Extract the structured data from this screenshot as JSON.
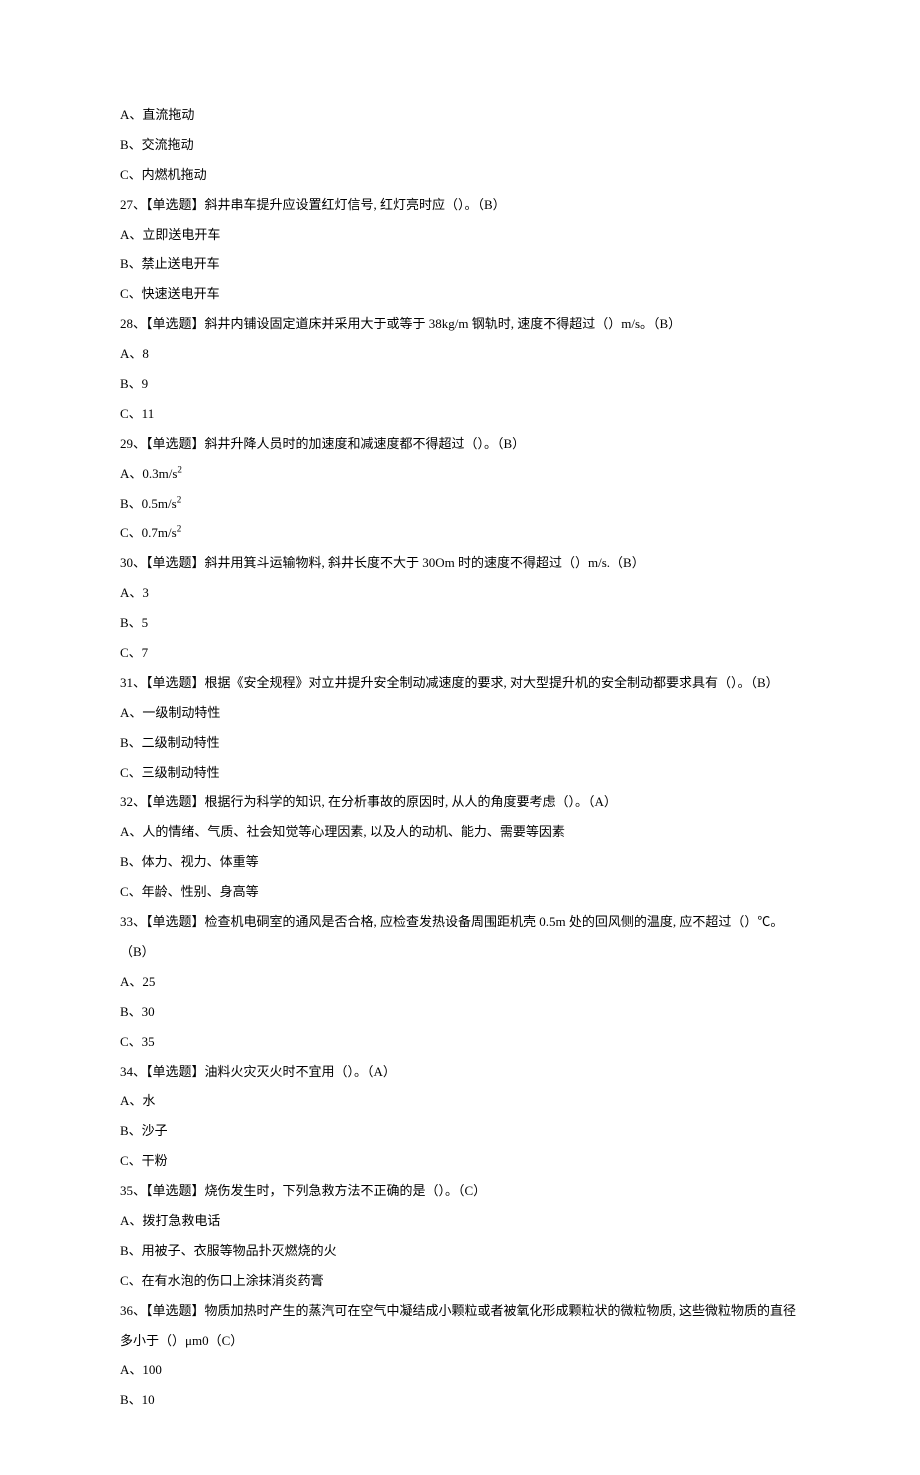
{
  "lines": [
    "A、直流拖动",
    "B、交流拖动",
    "C、内燃机拖动",
    "27、【单选题】斜井串车提升应设置红灯信号, 红灯亮时应（）。（B）",
    "A、立即送电开车",
    "B、禁止送电开车",
    "C、快速送电开车",
    "28、【单选题】斜井内铺设固定道床并采用大于或等于 38kg/m 钢轨时, 速度不得超过（）m/s。（B）",
    "A、8",
    "B、9",
    "C、11",
    "29、【单选题】斜井升降人员时的加速度和减速度都不得超过（）。（B）",
    "A、0.3m/s²",
    "B、0.5m/s²",
    "C、0.7m/s²",
    "30、【单选题】斜井用箕斗运输物料, 斜井长度不大于 30Om 时的速度不得超过（）m/s.（B）",
    "A、3",
    "B、5",
    "C、7",
    "31、【单选题】根据《安全规程》对立井提升安全制动减速度的要求, 对大型提升机的安全制动都要求具有（）。（B）",
    "A、一级制动特性",
    "B、二级制动特性",
    "C、三级制动特性",
    "32、【单选题】根据行为科学的知识, 在分析事故的原因时, 从人的角度要考虑（）。（A）",
    "A、人的情绪、气质、社会知觉等心理因素, 以及人的动机、能力、需要等因素",
    "B、体力、视力、体重等",
    "C、年龄、性别、身高等",
    "33、【单选题】检查机电硐室的通风是否合格, 应检查发热设备周围距机壳 0.5m 处的回风侧的温度, 应不超过（）℃。（B）",
    "A、25",
    "B、30",
    "C、35",
    "34、【单选题】油料火灾灭火时不宜用（）。（A）",
    "A、水",
    "B、沙子",
    "C、干粉",
    "35、【单选题】烧伤发生时，下列急救方法不正确的是（）。（C）",
    "A、拨打急救电话",
    "B、用被子、衣服等物品扑灭燃烧的火",
    "C、在有水泡的伤口上涂抹消炎药膏",
    "36、【单选题】物质加热时产生的蒸汽可在空气中凝结成小颗粒或者被氧化形成颗粒状的微粒物质, 这些微粒物质的直径多小于（）μm0（C）",
    "A、100",
    "B、10"
  ]
}
